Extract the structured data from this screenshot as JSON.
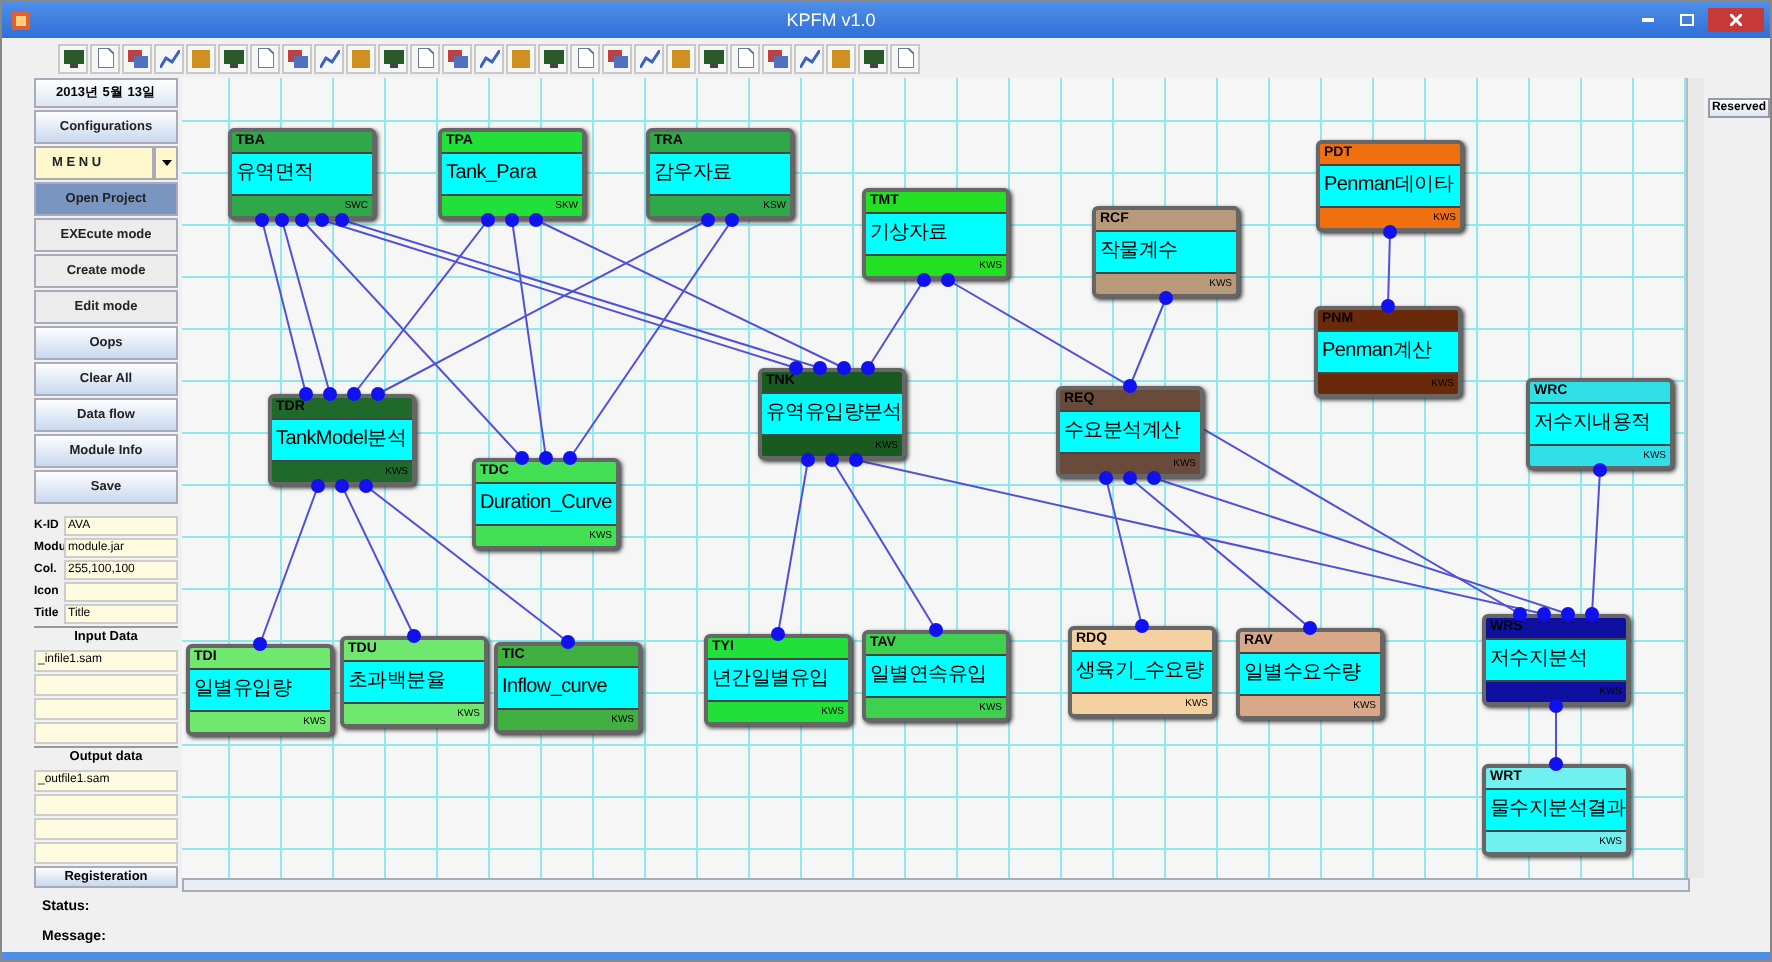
{
  "window": {
    "title": "KPFM v1.0"
  },
  "sidebar": {
    "date": "2013년 5월 13일",
    "buttons": [
      {
        "label": "Configurations",
        "kind": "gradient",
        "selected": false
      },
      {
        "label": "M E N U",
        "kind": "menu",
        "selected": false
      },
      {
        "label": "Open Project",
        "kind": "gradient",
        "selected": true
      },
      {
        "label": "EXEcute mode",
        "kind": "plain",
        "selected": false
      },
      {
        "label": "Create mode",
        "kind": "plain",
        "selected": false
      },
      {
        "label": "Edit mode",
        "kind": "plain",
        "selected": false
      },
      {
        "label": "Oops",
        "kind": "gradient",
        "selected": false
      },
      {
        "label": "Clear All",
        "kind": "gradient",
        "selected": false
      },
      {
        "label": "Data flow",
        "kind": "gradient",
        "selected": false
      },
      {
        "label": "Module Info",
        "kind": "gradient",
        "selected": false
      },
      {
        "label": "Save",
        "kind": "gradient",
        "selected": false
      }
    ],
    "properties": [
      {
        "label": "K-ID",
        "value": "AVA"
      },
      {
        "label": "Modu",
        "value": "module.jar"
      },
      {
        "label": "Col.",
        "value": "255,100,100"
      },
      {
        "label": "Icon"
      },
      {
        "label": "Title",
        "value": "Title"
      }
    ],
    "input_data": {
      "title": "Input Data",
      "rows": [
        "_infile1.sam"
      ]
    },
    "output_data": {
      "title": "Output data",
      "rows": [
        "_outfile1.sam"
      ]
    },
    "register_button": "Registeration"
  },
  "canvas": {
    "nodes": [
      {
        "code": "TBA",
        "title": "유역면적",
        "footer": "SWC",
        "color": "#2fa84a"
      },
      {
        "code": "TPA",
        "title": "Tank_Para",
        "footer": "SKW",
        "color": "#22e03a"
      },
      {
        "code": "TRA",
        "title": "감우자료",
        "footer": "KSW",
        "color": "#2fa84a"
      },
      {
        "code": "TMT",
        "title": "기상자료",
        "footer": "KWS",
        "color": "#22e022"
      },
      {
        "code": "RCF",
        "title": "작물계수",
        "footer": "KWS",
        "color": "#b89a7a"
      },
      {
        "code": "PDT",
        "title": "Penman데이타",
        "footer": "KWS",
        "color": "#f07010"
      },
      {
        "code": "PNM",
        "title": "Penman계산",
        "footer": "KWS",
        "color": "#6a2a0a"
      },
      {
        "code": "TDR",
        "title": "TankModel분석",
        "footer": "KWS",
        "color": "#1f6a2a"
      },
      {
        "code": "TDC",
        "title": "Duration_Curve",
        "footer": "KWS",
        "color": "#44e054"
      },
      {
        "code": "TNK",
        "title": "유역유입량분석",
        "footer": "KWS",
        "color": "#185a20"
      },
      {
        "code": "REQ",
        "title": "수요분석계산",
        "footer": "KWS",
        "color": "#6a4a3a"
      },
      {
        "code": "WRC",
        "title": "저수지내용적",
        "footer": "KWS",
        "color": "#30e0e8"
      },
      {
        "code": "TDI",
        "title": "일별유입량",
        "footer": "KWS",
        "color": "#70e870"
      },
      {
        "code": "TDU",
        "title": "초과백분율",
        "footer": "KWS",
        "color": "#70e870"
      },
      {
        "code": "TIC",
        "title": "Inflow_curve",
        "footer": "KWS",
        "color": "#40b040"
      },
      {
        "code": "TYI",
        "title": "년간일별유입",
        "footer": "KWS",
        "color": "#22e03a"
      },
      {
        "code": "TAV",
        "title": "일별연속유입",
        "footer": "KWS",
        "color": "#40d050"
      },
      {
        "code": "RDQ",
        "title": "생육기_수요량",
        "footer": "KWS",
        "color": "#f5d0a0"
      },
      {
        "code": "RAV",
        "title": "일별수요수량",
        "footer": "KWS",
        "color": "#d8a888"
      },
      {
        "code": "WRS",
        "title": "저수지분석",
        "footer": "KWS",
        "color": "#1010a0"
      },
      {
        "code": "WRT",
        "title": "물수지분석결과",
        "footer": "KWS",
        "color": "#70f0f0"
      }
    ]
  },
  "right_panel": {
    "button": "Reserved"
  },
  "status": {
    "status_label": "Status:",
    "message_label": "Message:"
  }
}
